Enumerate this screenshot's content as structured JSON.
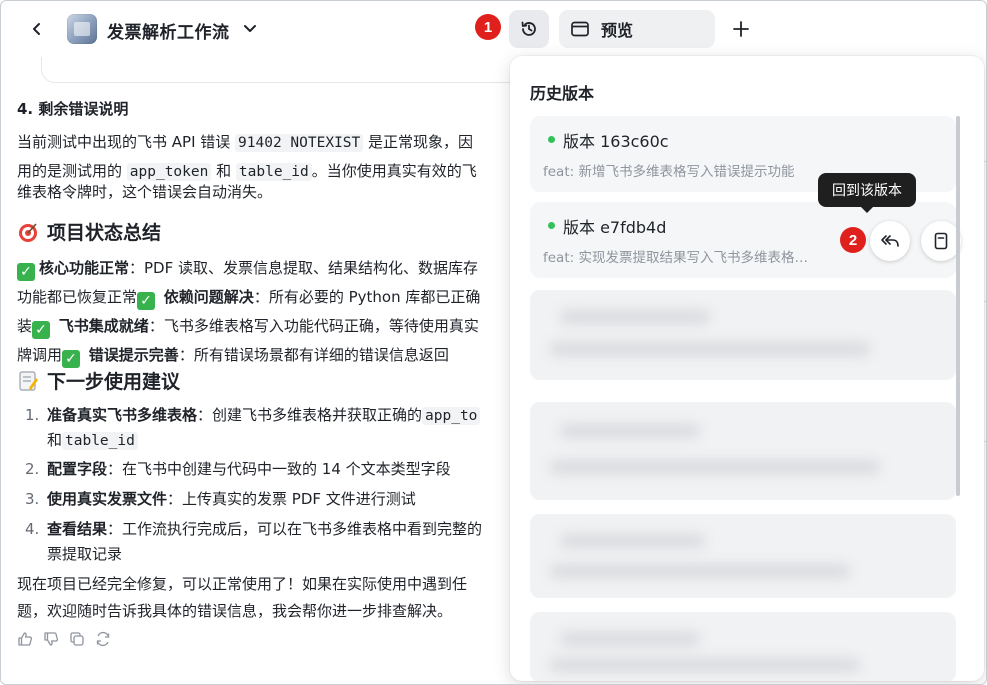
{
  "header": {
    "title": "发票解析工作流",
    "preview_label": "预览",
    "badge_1": "1",
    "badge_2": "2"
  },
  "chat": {
    "section4_title": "4. 剩余错误说明",
    "section4_line1_a": "当前测试中出现的飞书 API 错误 ",
    "section4_code1": "91402 NOTEXIST",
    "section4_line1_b": " 是正常现象，因",
    "section4_line2_a": "用的是测试用的 ",
    "section4_code2": "app_token",
    "section4_line2_b": " 和 ",
    "section4_code3": "table_id",
    "section4_line2_c": "。当你使用真实有效的飞",
    "section4_line3": "维表格令牌时，这个错误会自动消失。",
    "status_title": "项目状态总结",
    "status_l1_b": "核心功能正常",
    "status_l1_t": "：PDF 读取、发票信息提取、结果结构化、数据库存",
    "status_l2_t": "功能都已恢复正常",
    "status_l2_b": "依赖问题解决",
    "status_l2_t2": "：所有必要的 Python 库都已正确",
    "status_l3_t": "装",
    "status_l3_b": "飞书集成就绪",
    "status_l3_t2": "：飞书多维表格写入功能代码正确，等待使用真实",
    "status_l4_t": "牌调用",
    "status_l4_b": "错误提示完善",
    "status_l4_t2": "：所有错误场景都有详细的错误信息返回",
    "next_title": "下一步使用建议",
    "steps": [
      {
        "num": "1.",
        "bold": "准备真实飞书多维表格",
        "text": "：创建飞书多维表格并获取正确的",
        "code": "app_to"
      },
      {
        "num": "",
        "bold": "",
        "text": "和",
        "code": "table_id"
      },
      {
        "num": "2.",
        "bold": "配置字段",
        "text": "：在飞书中创建与代码中一致的 14 个文本类型字段",
        "code": ""
      },
      {
        "num": "3.",
        "bold": "使用真实发票文件",
        "text": "：上传真实的发票 PDF 文件进行测试",
        "code": ""
      },
      {
        "num": "4.",
        "bold": "查看结果",
        "text": "：工作流执行完成后，可以在飞书多维表格中看到完整的",
        "code": ""
      },
      {
        "num": "",
        "bold": "",
        "text": "票提取记录",
        "code": ""
      }
    ],
    "closing_1": "现在项目已经完全修复，可以正常使用了！如果在实际使用中遇到任",
    "closing_2": "题，欢迎随时告诉我具体的错误信息，我会帮你进一步排查解决。"
  },
  "history": {
    "title": "历史版本",
    "tooltip": "回到该版本",
    "versions": [
      {
        "name": "版本 163c60c",
        "desc": "feat: 新增飞书多维表格写入错误提示功能"
      },
      {
        "name": "版本 e7fdb4d",
        "desc": "feat: 实现发票提取结果写入飞书多维表格…"
      }
    ]
  },
  "colors": {
    "badge": "#e0201c",
    "version_dot": "#33c15c",
    "check": "#37b24d"
  }
}
